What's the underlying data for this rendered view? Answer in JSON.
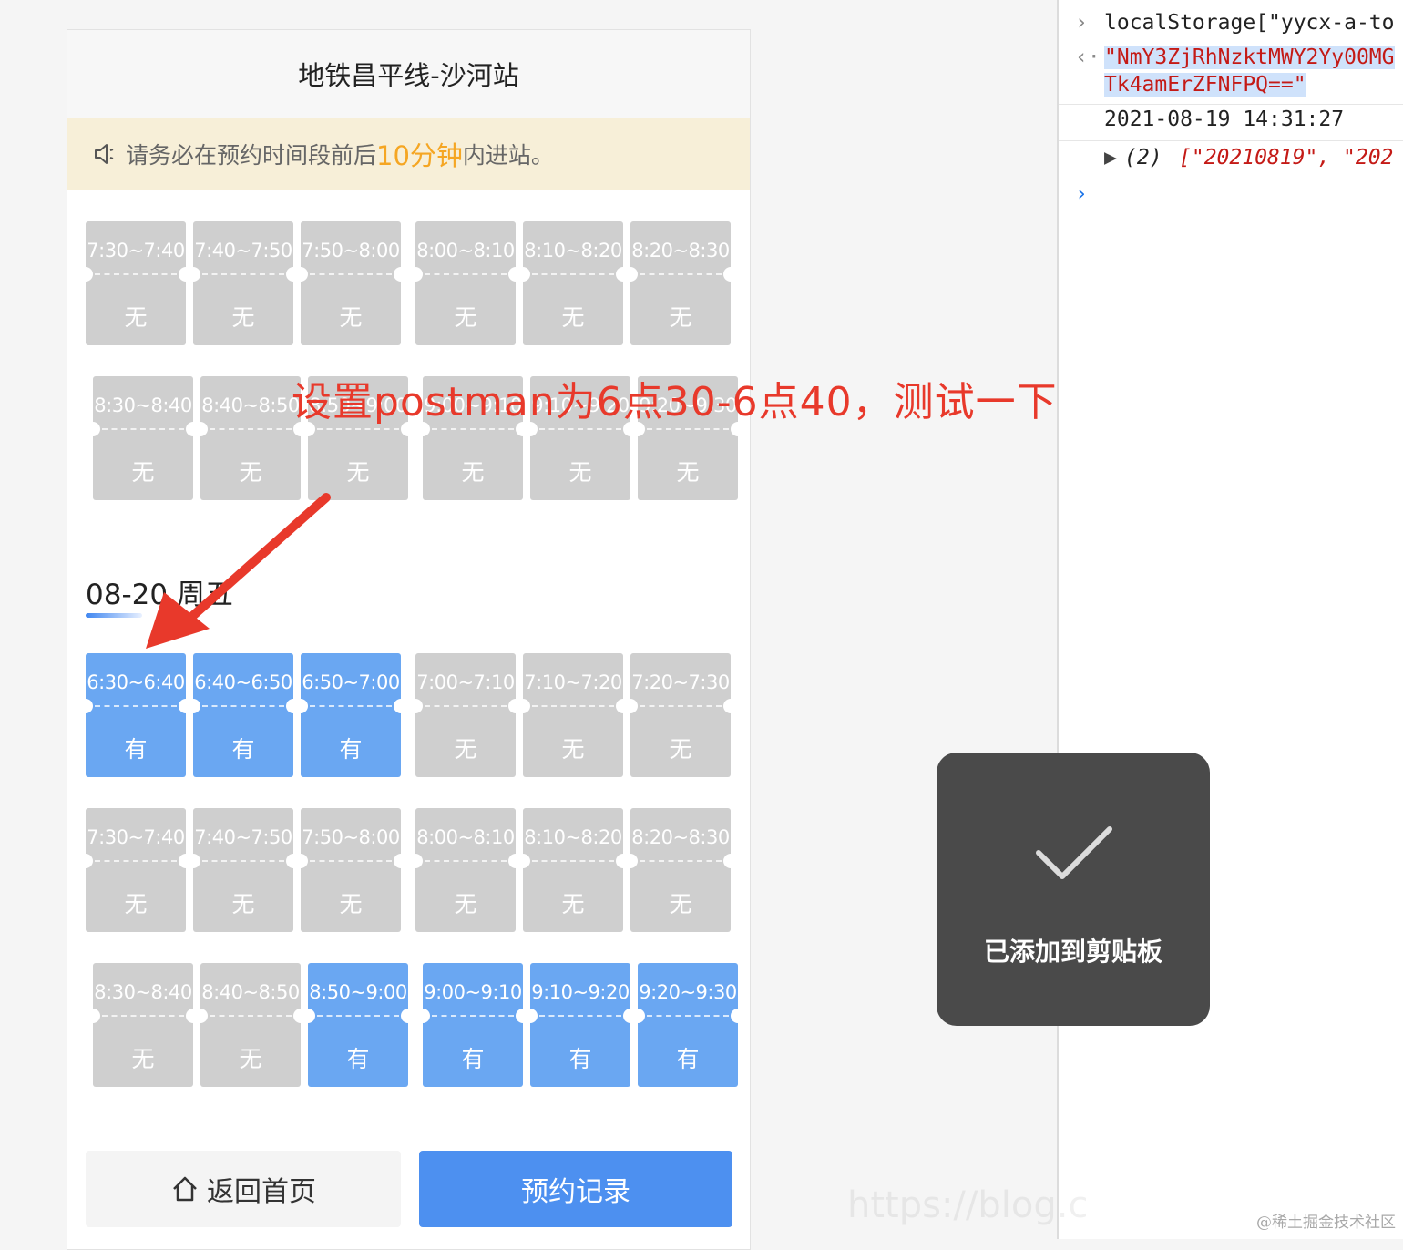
{
  "app": {
    "title": "地铁昌平线-沙河站",
    "notice_prefix": "请务必在预约时间段前后",
    "notice_highlight": "10分钟",
    "notice_suffix": "内进站。"
  },
  "day1": {
    "rows": [
      [
        {
          "time": "7:30~7:40",
          "status": "无",
          "available": false
        },
        {
          "time": "7:40~7:50",
          "status": "无",
          "available": false
        },
        {
          "time": "7:50~8:00",
          "status": "无",
          "available": false
        },
        {
          "time": "8:00~8:10",
          "status": "无",
          "available": false
        },
        {
          "time": "8:10~8:20",
          "status": "无",
          "available": false
        },
        {
          "time": "8:20~8:30",
          "status": "无",
          "available": false
        }
      ],
      [
        {
          "time": "8:30~8:40",
          "status": "无",
          "available": false
        },
        {
          "time": "8:40~8:50",
          "status": "无",
          "available": false
        },
        {
          "time": "8:50~9:00",
          "status": "无",
          "available": false
        },
        {
          "time": "9:00~9:10",
          "status": "无",
          "available": false
        },
        {
          "time": "9:10~9:20",
          "status": "无",
          "available": false
        },
        {
          "time": "9:20~9:30",
          "status": "无",
          "available": false
        }
      ]
    ]
  },
  "day2": {
    "label": "08-20 周五",
    "rows": [
      [
        {
          "time": "6:30~6:40",
          "status": "有",
          "available": true
        },
        {
          "time": "6:40~6:50",
          "status": "有",
          "available": true
        },
        {
          "time": "6:50~7:00",
          "status": "有",
          "available": true
        },
        {
          "time": "7:00~7:10",
          "status": "无",
          "available": false
        },
        {
          "time": "7:10~7:20",
          "status": "无",
          "available": false
        },
        {
          "time": "7:20~7:30",
          "status": "无",
          "available": false
        }
      ],
      [
        {
          "time": "7:30~7:40",
          "status": "无",
          "available": false
        },
        {
          "time": "7:40~7:50",
          "status": "无",
          "available": false
        },
        {
          "time": "7:50~8:00",
          "status": "无",
          "available": false
        },
        {
          "time": "8:00~8:10",
          "status": "无",
          "available": false
        },
        {
          "time": "8:10~8:20",
          "status": "无",
          "available": false
        },
        {
          "time": "8:20~8:30",
          "status": "无",
          "available": false
        }
      ],
      [
        {
          "time": "8:30~8:40",
          "status": "无",
          "available": false
        },
        {
          "time": "8:40~8:50",
          "status": "无",
          "available": false
        },
        {
          "time": "8:50~9:00",
          "status": "有",
          "available": true
        },
        {
          "time": "9:00~9:10",
          "status": "有",
          "available": true
        },
        {
          "time": "9:10~9:20",
          "status": "有",
          "available": true
        },
        {
          "time": "9:20~9:30",
          "status": "有",
          "available": true
        }
      ]
    ]
  },
  "buttons": {
    "home": "返回首页",
    "records": "预约记录"
  },
  "annotation": "设置postman为6点30-6点40，测试一下。",
  "devtools": {
    "input1": "localStorage[\"yycx-a-to",
    "output1_line1": "\"NmY3ZjRhNzktMWY2Yy00MG",
    "output1_line2": "Tk4amErZFNFPQ==\"",
    "log": "2021-08-19 14:31:27",
    "array_count": "(2)",
    "array_items": "[\"20210819\", \"202"
  },
  "toast": {
    "message": "已添加到剪贴板"
  },
  "watermark": "@稀土掘金技术社区",
  "faint_url": "https://blog.c",
  "colors": {
    "available": "#6aa7f2",
    "unavailable": "#cfcfcf",
    "primary_button": "#4d90f0",
    "annotation": "#e8392b",
    "notice_highlight": "#f5a623"
  }
}
